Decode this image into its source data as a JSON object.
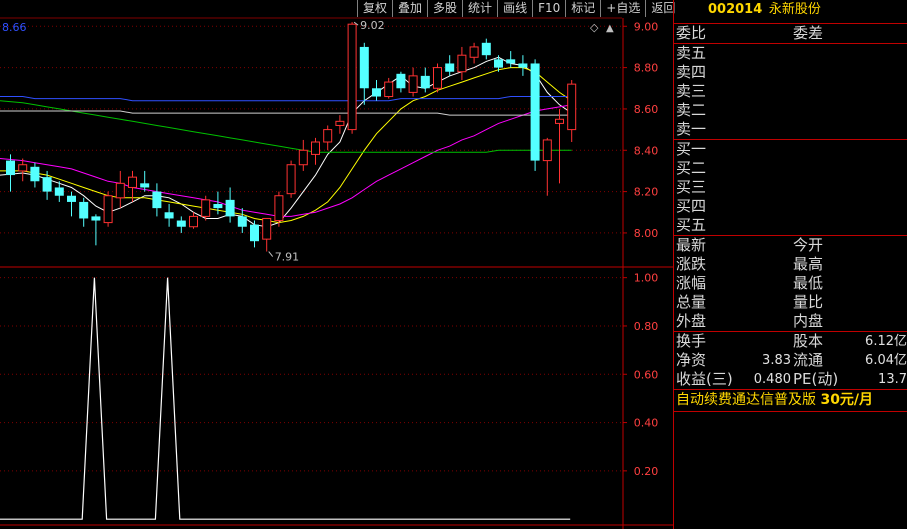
{
  "toolbar": {
    "buttons": [
      "复权",
      "叠加",
      "多股",
      "统计",
      "画线",
      "F10",
      "标记",
      "+自选",
      "返回"
    ]
  },
  "stock": {
    "code": "002014",
    "name": "永新股份"
  },
  "header": {
    "price_readout": "8.66"
  },
  "orderbook": {
    "top": [
      [
        "委比",
        "委差"
      ]
    ],
    "sell": [
      "卖五",
      "卖四",
      "卖三",
      "卖二",
      "卖一"
    ],
    "buy": [
      "买一",
      "买二",
      "买三",
      "买四",
      "买五"
    ],
    "quote": [
      [
        "最新",
        "今开"
      ],
      [
        "涨跌",
        "最高"
      ],
      [
        "涨幅",
        "最低"
      ],
      [
        "总量",
        "量比"
      ],
      [
        "外盘",
        "内盘"
      ]
    ],
    "fundamentals": [
      {
        "l1": "换手",
        "v1": "",
        "l2": "股本",
        "v2": "6.12亿"
      },
      {
        "l1": "净资",
        "v1": "3.83",
        "l2": "流通",
        "v2": "6.04亿"
      },
      {
        "l1": "收益(三)",
        "v1": "0.480",
        "l2": "PE(动)",
        "v2": "13.7"
      }
    ],
    "ad": {
      "text": "自动续费通达信普及版",
      "price": "30元/月"
    }
  },
  "colors": {
    "up": "#ff3232",
    "down": "#54ffff",
    "ma5": "#ffffff",
    "ma10": "#ffff00",
    "ma20": "#ff00ff",
    "ma60": "#00c000",
    "ma120": "#3050ff",
    "grid": "#800000"
  },
  "chart_data": [
    {
      "type": "candlestick",
      "y_ticks": [
        "9.00",
        "8.80",
        "8.60",
        "8.40",
        "8.20",
        "8.00"
      ],
      "ylim": [
        7.84,
        9.04
      ],
      "annotations": [
        {
          "text": "9.02",
          "price": 9.02
        },
        {
          "text": "7.91",
          "price": 7.91
        }
      ],
      "ohlc": [
        [
          8.35,
          8.38,
          8.2,
          8.28
        ],
        [
          8.3,
          8.36,
          8.25,
          8.33
        ],
        [
          8.32,
          8.34,
          8.22,
          8.25
        ],
        [
          8.27,
          8.3,
          8.16,
          8.2
        ],
        [
          8.22,
          8.25,
          8.15,
          8.18
        ],
        [
          8.18,
          8.2,
          8.08,
          8.15
        ],
        [
          8.15,
          8.17,
          8.03,
          8.07
        ],
        [
          8.08,
          8.09,
          7.94,
          8.06
        ],
        [
          8.05,
          8.2,
          8.03,
          8.18
        ],
        [
          8.17,
          8.3,
          8.12,
          8.24
        ],
        [
          8.22,
          8.3,
          8.15,
          8.27
        ],
        [
          8.24,
          8.3,
          8.2,
          8.22
        ],
        [
          8.2,
          8.24,
          8.08,
          8.12
        ],
        [
          8.1,
          8.14,
          8.03,
          8.07
        ],
        [
          8.06,
          8.08,
          8.0,
          8.03
        ],
        [
          8.03,
          8.1,
          8.02,
          8.08
        ],
        [
          8.08,
          8.18,
          8.06,
          8.16
        ],
        [
          8.14,
          8.2,
          8.09,
          8.12
        ],
        [
          8.16,
          8.22,
          8.05,
          8.08
        ],
        [
          8.08,
          8.12,
          8.0,
          8.03
        ],
        [
          8.04,
          8.06,
          7.93,
          7.96
        ],
        [
          7.97,
          8.06,
          7.91,
          8.07
        ],
        [
          8.06,
          8.2,
          8.03,
          8.18
        ],
        [
          8.19,
          8.35,
          8.17,
          8.33
        ],
        [
          8.33,
          8.45,
          8.3,
          8.4
        ],
        [
          8.38,
          8.46,
          8.33,
          8.44
        ],
        [
          8.44,
          8.52,
          8.4,
          8.5
        ],
        [
          8.52,
          8.57,
          8.48,
          8.54
        ],
        [
          8.5,
          9.02,
          8.48,
          9.01
        ],
        [
          8.9,
          8.92,
          8.62,
          8.7
        ],
        [
          8.7,
          8.74,
          8.64,
          8.66
        ],
        [
          8.66,
          8.75,
          8.65,
          8.73
        ],
        [
          8.77,
          8.78,
          8.68,
          8.7
        ],
        [
          8.68,
          8.8,
          8.66,
          8.76
        ],
        [
          8.76,
          8.8,
          8.68,
          8.7
        ],
        [
          8.7,
          8.82,
          8.68,
          8.8
        ],
        [
          8.82,
          8.86,
          8.76,
          8.78
        ],
        [
          8.78,
          8.9,
          8.74,
          8.86
        ],
        [
          8.85,
          8.92,
          8.82,
          8.9
        ],
        [
          8.92,
          8.94,
          8.84,
          8.86
        ],
        [
          8.84,
          8.86,
          8.78,
          8.8
        ],
        [
          8.84,
          8.88,
          8.8,
          8.82
        ],
        [
          8.82,
          8.86,
          8.76,
          8.8
        ],
        [
          8.82,
          8.84,
          8.3,
          8.35
        ],
        [
          8.35,
          8.46,
          8.18,
          8.45
        ],
        [
          8.53,
          8.6,
          8.24,
          8.55
        ],
        [
          8.5,
          8.74,
          8.44,
          8.72
        ]
      ],
      "ma": {
        "ma5": [
          8.28,
          8.29,
          8.28,
          8.26,
          8.24,
          8.22,
          8.18,
          8.13,
          8.1,
          8.12,
          8.15,
          8.18,
          8.18,
          8.17,
          8.14,
          8.1,
          8.07,
          8.07,
          8.09,
          8.08,
          8.04,
          8.03,
          8.05,
          8.12,
          8.2,
          8.28,
          8.38,
          8.44,
          8.58,
          8.64,
          8.68,
          8.72,
          8.76,
          8.71,
          8.7,
          8.73,
          8.76,
          8.78,
          8.8,
          8.83,
          8.85,
          8.82,
          8.81,
          8.77,
          8.68,
          8.62,
          8.58
        ],
        "ma10": [
          8.3,
          8.3,
          8.29,
          8.28,
          8.26,
          8.24,
          8.22,
          8.2,
          8.18,
          8.17,
          8.17,
          8.17,
          8.16,
          8.15,
          8.14,
          8.13,
          8.12,
          8.11,
          8.1,
          8.09,
          8.07,
          8.06,
          8.05,
          8.06,
          8.08,
          8.11,
          8.15,
          8.22,
          8.31,
          8.4,
          8.48,
          8.54,
          8.6,
          8.64,
          8.66,
          8.69,
          8.71,
          8.73,
          8.75,
          8.77,
          8.79,
          8.8,
          8.8,
          8.78,
          8.73,
          8.68,
          8.64
        ],
        "ma20": [
          8.36,
          8.35,
          8.34,
          8.33,
          8.32,
          8.31,
          8.29,
          8.27,
          8.25,
          8.24,
          8.22,
          8.21,
          8.2,
          8.19,
          8.18,
          8.17,
          8.16,
          8.15,
          8.13,
          8.11,
          8.1,
          8.09,
          8.08,
          8.08,
          8.09,
          8.1,
          8.12,
          8.14,
          8.17,
          8.21,
          8.25,
          8.28,
          8.31,
          8.34,
          8.37,
          8.4,
          8.42,
          8.45,
          8.47,
          8.5,
          8.53,
          8.55,
          8.57,
          8.59,
          8.6,
          8.61,
          8.62
        ],
        "ma60": [
          8.64,
          8.63,
          8.62,
          8.61,
          8.6,
          8.59,
          8.58,
          8.57,
          8.56,
          8.55,
          8.54,
          8.53,
          8.52,
          8.51,
          8.5,
          8.49,
          8.48,
          8.47,
          8.46,
          8.45,
          8.44,
          8.43,
          8.42,
          8.41,
          8.4,
          8.39,
          8.39,
          8.39,
          8.39,
          8.39,
          8.39,
          8.39,
          8.39,
          8.39,
          8.39,
          8.39,
          8.39,
          8.39,
          8.39,
          8.39,
          8.4,
          8.4,
          8.4,
          8.4,
          8.4,
          8.4,
          8.4
        ],
        "ma120": [
          8.66,
          8.66,
          8.65,
          8.65,
          8.65,
          8.65,
          8.65,
          8.65,
          8.65,
          8.65,
          8.64,
          8.64,
          8.64,
          8.64,
          8.64,
          8.64,
          8.64,
          8.64,
          8.64,
          8.64,
          8.64,
          8.64,
          8.64,
          8.64,
          8.64,
          8.64,
          8.64,
          8.64,
          8.64,
          8.64,
          8.64,
          8.64,
          8.65,
          8.65,
          8.65,
          8.65,
          8.65,
          8.65,
          8.65,
          8.65,
          8.65,
          8.66,
          8.66,
          8.66,
          8.66,
          8.66,
          8.66
        ],
        "ma250": [
          8.59,
          8.59,
          8.59,
          8.59,
          8.59,
          8.59,
          8.59,
          8.59,
          8.59,
          8.59,
          8.58,
          8.58,
          8.58,
          8.58,
          8.58,
          8.58,
          8.58,
          8.58,
          8.58,
          8.58,
          8.58,
          8.58,
          8.58,
          8.58,
          8.58,
          8.58,
          8.58,
          8.58,
          8.58,
          8.58,
          8.58,
          8.58,
          8.58,
          8.58,
          8.58,
          8.58,
          8.57,
          8.57,
          8.57,
          8.57,
          8.57,
          8.57,
          8.57,
          8.57,
          8.57,
          8.57,
          8.57
        ]
      }
    },
    {
      "type": "line",
      "y_ticks": [
        "1.00",
        "0.80",
        "0.60",
        "0.40",
        "0.20"
      ],
      "ylim": [
        -0.02,
        1.04
      ],
      "values": [
        0,
        0,
        0,
        0,
        0,
        0,
        0,
        1,
        0,
        0,
        0,
        0,
        0,
        1,
        0,
        0,
        0,
        0,
        0,
        0,
        0,
        0,
        0,
        0,
        0,
        0,
        0,
        0,
        0,
        0,
        0,
        0,
        0,
        0,
        0,
        0,
        0,
        0,
        0,
        0,
        0,
        0,
        0,
        0,
        0,
        0,
        0
      ]
    }
  ]
}
